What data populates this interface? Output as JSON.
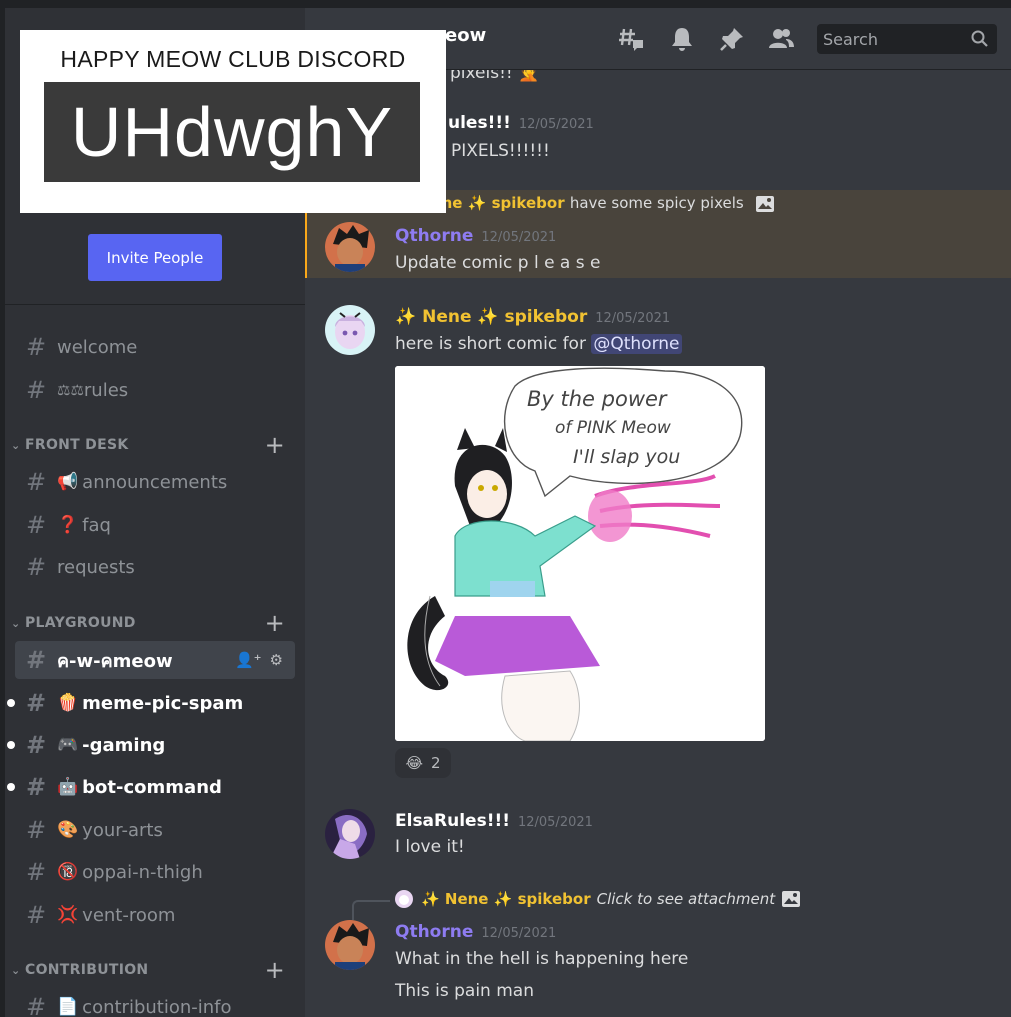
{
  "brand": {
    "title": "HAPPY MEOW CLUB DISCORD",
    "code": "UHdwghY"
  },
  "sidebar": {
    "invite_label": "Invite People",
    "channels_top": [
      {
        "label": "welcome"
      },
      {
        "label": "rules",
        "emoji": "⚖⚖"
      }
    ],
    "categories": {
      "front_desk": "FRONT DESK",
      "playground": "PLAYGROUND",
      "contribution": "CONTRIBUTION"
    },
    "front_desk": [
      {
        "label": "announcements",
        "emoji": "📢"
      },
      {
        "label": "faq",
        "emoji": "❓"
      },
      {
        "label": "requests"
      }
    ],
    "playground": [
      {
        "label": "ค-w-คmeow"
      },
      {
        "label": "meme-pic-spam",
        "emoji": "🍿"
      },
      {
        "label": "-gaming",
        "emoji": "🎮"
      },
      {
        "label": "bot-command",
        "emoji": "🤖"
      },
      {
        "label": "your-arts",
        "emoji": "🎨"
      },
      {
        "label": "oppai-n-thigh",
        "emoji": "🔞"
      },
      {
        "label": "vent-room",
        "emoji": "💢"
      }
    ],
    "contribution": [
      {
        "label": "contribution-info",
        "emoji": "📄"
      }
    ]
  },
  "header": {
    "title": "eow",
    "search_placeholder": "Search"
  },
  "messages": {
    "m0_text": "pixels!! 🤦",
    "m1_author": "ules!!!",
    "m1_time": "12/05/2021",
    "m1_text": "PIXELS!!!!!!",
    "m2_reply_author": "✨ Nene ✨ spikebor",
    "m2_reply_text": "have some spicy pixels",
    "m2_author": "Qthorne",
    "m2_time": "12/05/2021",
    "m2_text": "Update comic p l e a s e",
    "m3_author": "✨ Nene ✨ spikebor",
    "m3_time": "12/05/2021",
    "m3_text": "here is short comic for ",
    "m3_mention": "@Qthorne",
    "m3_bubble_lines": [
      "By the power",
      "of PINK Meow",
      "I'll slap you"
    ],
    "m3_reaction_emoji": "😂",
    "m3_reaction_count": "2",
    "m4_author": "ElsaRules!!!",
    "m4_time": "12/05/2021",
    "m4_text": "I love it!",
    "m5_reply_author": "✨ Nene ✨ spikebor",
    "m5_reply_text": "Click to see attachment",
    "m5_author": "Qthorne",
    "m5_time": "12/05/2021",
    "m5_text1": "What in the hell is happening here",
    "m5_text2": "This is pain man"
  },
  "colors": {
    "qthorne": "#8e7cf1",
    "nene": "#f1c232",
    "elsa": "#ffffff",
    "accent": "#5865f2"
  }
}
